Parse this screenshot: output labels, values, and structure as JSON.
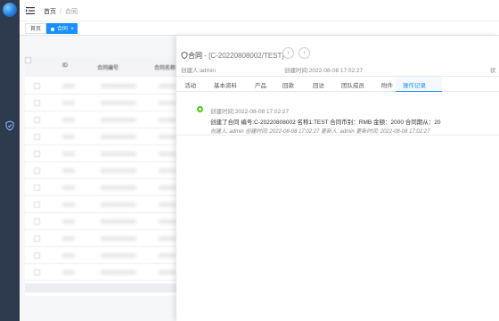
{
  "breadcrumb": {
    "home": "首页",
    "current": "合同"
  },
  "tags": {
    "home": "首页",
    "contract": "合同",
    "close_glyph": "×"
  },
  "table": {
    "header_id": "ID",
    "header_number": "合同编号",
    "header_name": "合同名称"
  },
  "panel": {
    "title": "合同",
    "number": " - [C-20220808002/TEST]",
    "prev_glyph": "‹",
    "next_glyph": "›",
    "creator": "创建人:admin",
    "created_time": "创建时间:2022-08-08 17:02:27",
    "status_label": "状"
  },
  "tabs": [
    "活动",
    "基本资料",
    "产品",
    "回款",
    "回访",
    "团队成员",
    "附件",
    "操作记录"
  ],
  "active_tab_index": 7,
  "log": {
    "time": "创建时间:2022-08-08 17:02:27",
    "content": "创建了合同 编号:C-20220808002 名称1:TEST 合同币别：RMB 金额：2000 合同期从：20",
    "footer": "创建人: admin 创建时间: 2022-08-08 17:02:27 更新人: admin 更新时间: 2022-08-08 17:02:27"
  },
  "colors": {
    "accent": "#1890ff",
    "sidebar": "#2e3a4d",
    "success": "#52c41a"
  }
}
